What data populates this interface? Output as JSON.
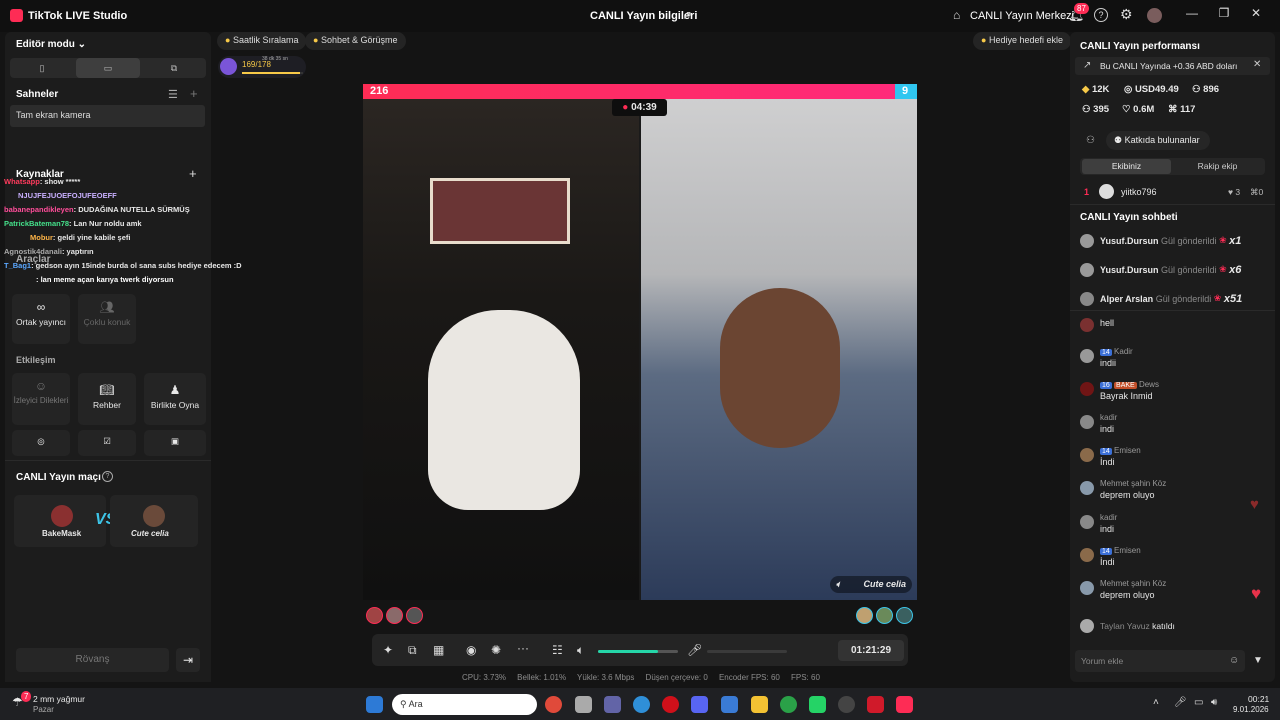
{
  "titlebar": {
    "app_name": "TikTok LIVE Studio",
    "center_title": "CANLI Yayın bilgileri",
    "center_link": "CANLI Yayın Merkezi",
    "notif_count": "87"
  },
  "left": {
    "editor_mode": "Editör modu",
    "scenes_title": "Sahneler",
    "scene_item": "Tam ekran kamera",
    "sources_title": "Kaynaklar",
    "tools_title": "Araçlar",
    "tile_cohost": "Ortak yayıncı",
    "tile_multiguest": "Çoklu konuk",
    "interaction_title": "Etkileşim",
    "tile_viewer_wishes": "İzleyici Dilekleri",
    "tile_guide": "Rehber",
    "tile_play_together": "Birlikte Oyna",
    "match_title": "CANLI Yayın maçı",
    "player1": "BakeMask",
    "player2": "Cute celia",
    "rematch": "Rövanş"
  },
  "chat_overlay": [
    {
      "user": "Whatsapp",
      "msg": ": show *****",
      "color": "#ff3b5c"
    },
    {
      "user": "",
      "msg": "NJUJFEJUOEFOJUFEOEFF",
      "color": "#c9b0ff"
    },
    {
      "user": "babanepandikleyen",
      "msg": ": DUDAĞINA NUTELLA SÜRMÜŞ",
      "color": "#ff4d9a"
    },
    {
      "user": "PatrickBateman78",
      "msg": ": Lan Nur noldu amk",
      "color": "#44e08a"
    },
    {
      "user": "Mobur",
      "msg": ": geldi yine kabile şefi",
      "color": "#ffb547"
    },
    {
      "user": "Agnostik4danali",
      "msg": ": yaptırın",
      "color": "#aaaaaa"
    },
    {
      "user": "T_Bag1",
      "msg": ": gedson ayın 15inde burda ol sana subs hediye edecem :D",
      "color": "#5aa7ff"
    },
    {
      "user": "",
      "msg": ": lan meme açan karıya twerk diyorsun",
      "color": "#ff3b5c"
    }
  ],
  "center": {
    "pill_ranking": "Saatlik Sıralama",
    "pill_chat": "Sohbet & Görüşme",
    "pill_gift_goal": "Hediye hedefi ekle",
    "progress_text": "169/178",
    "progress_fraction": 0.95,
    "progress_time": "38 dk 35 sn",
    "score_left": "216",
    "score_right": "9",
    "battle_timer": "04:39",
    "right_label": "Cute celia",
    "elapsed": "01:21:29",
    "volume_level": 0.75
  },
  "stats": {
    "cpu": "CPU: 3.73%",
    "memory": "Bellek: 1.01%",
    "upload": "Yükle: 3.6 Mbps",
    "dropped": "Düşen çerçeve: 0",
    "encoder_fps": "Encoder FPS: 60",
    "fps": "FPS: 60"
  },
  "right": {
    "perf_title": "CANLI Yayın performansı",
    "earning_banner": "Bu CANLI Yayında +0.36 ABD doları",
    "stat1": "12K",
    "stat2": "USD49.49",
    "stat3": "896",
    "stat4": "395",
    "stat5": "0.6M",
    "stat6": "117",
    "contributors": "Katkıda bulunanlar",
    "tab_our_team": "Ekibiniz",
    "tab_opponent": "Rakip ekip",
    "rank_num": "1",
    "rank_user": "yiitko796",
    "rank_likes": "3",
    "rank_gifts": "0",
    "chat_title": "CANLI Yayın sohbeti",
    "gifts": [
      {
        "user": "Yusuf.Dursun",
        "action": "Gül gönderildi",
        "count": "x1"
      },
      {
        "user": "Yusuf.Dursun",
        "action": "Gül gönderildi",
        "count": "x6"
      },
      {
        "user": "Alper Arslan",
        "action": "Gül gönderildi",
        "count": "x51"
      }
    ],
    "messages": [
      {
        "user": "",
        "badge": "",
        "msg": "hell"
      },
      {
        "user": "Kadir",
        "badge": "14",
        "msg": "indii"
      },
      {
        "user": "Dews",
        "badge": "16",
        "msg": "Bayrak Inmid"
      },
      {
        "user": "kadir",
        "badge": "",
        "msg": "indi"
      },
      {
        "user": "Emisen",
        "badge": "14",
        "msg": "İndi"
      },
      {
        "user": "Mehmet şahin Köz",
        "badge": "",
        "msg": "deprem oluyo"
      },
      {
        "user": "kadir",
        "badge": "",
        "msg": "indi"
      },
      {
        "user": "Emisen",
        "badge": "14",
        "msg": "İndi"
      },
      {
        "user": "Mehmet şahin Köz",
        "badge": "",
        "msg": "deprem oluyo"
      }
    ],
    "joined_user": "Taylan Yavuz",
    "joined_text": "katıldı",
    "comment_placeholder": "Yorum ekle"
  },
  "taskbar": {
    "weather": "2 mm yağmur",
    "weather_day": "Pazar",
    "weather_badge": "7",
    "search_placeholder": "Ara",
    "time": "00:21",
    "date": "9.01.2026"
  }
}
